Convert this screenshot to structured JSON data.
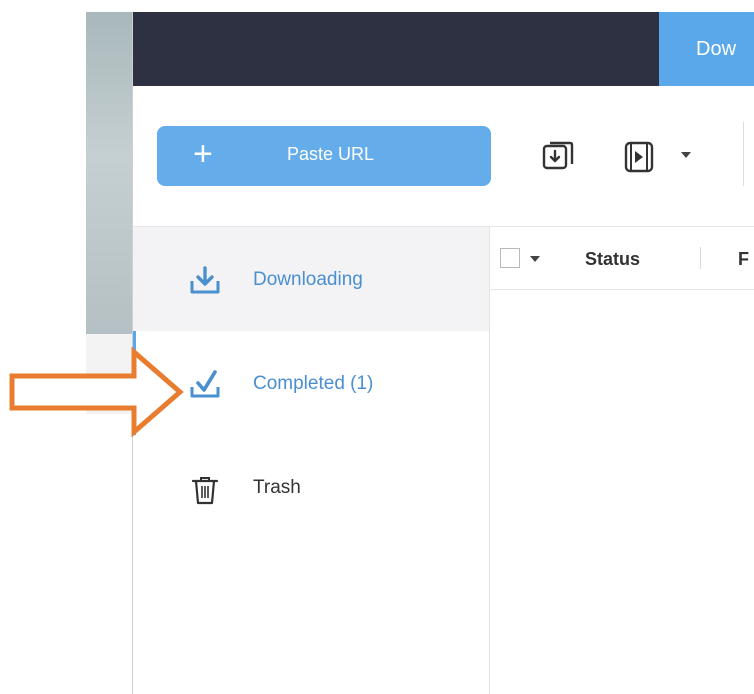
{
  "titlebar": {
    "tab_label": "Dow"
  },
  "toolbar": {
    "paste_url_label": "Paste URL",
    "plus_glyph": "+",
    "icons": [
      "download-box-icon",
      "video-download-icon"
    ]
  },
  "sidebar": {
    "items": [
      {
        "label": "Downloading",
        "icon": "download-icon",
        "color": "#4a8fd0",
        "active": true
      },
      {
        "label": "Completed (1)",
        "icon": "checkmark-icon",
        "color": "#4a8fd0",
        "active": false
      },
      {
        "label": "Trash",
        "icon": "trash-icon",
        "color": "#333333",
        "active": false
      }
    ]
  },
  "list": {
    "columns": [
      "Status",
      "F"
    ]
  },
  "colors": {
    "titlebar": "#2d3142",
    "accent": "#5aa7ea",
    "button": "#64acea",
    "annotation_arrow": "#e87d2f"
  }
}
